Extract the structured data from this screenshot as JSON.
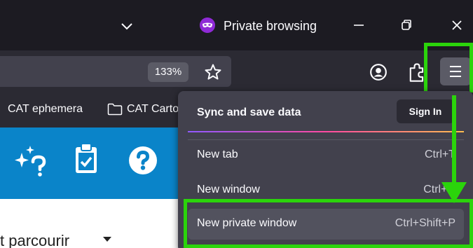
{
  "titlebar": {
    "private_label": "Private browsing"
  },
  "navbar": {
    "zoom_level": "133%"
  },
  "bookmarks": [
    {
      "label": "CAT ephemera"
    },
    {
      "label": "CAT Carto"
    }
  ],
  "page": {
    "browse_label": "t parcourir"
  },
  "app_menu": {
    "sync_title": "Sync and save data",
    "sign_in_label": "Sign In",
    "items": [
      {
        "label": "New tab",
        "shortcut": "Ctrl+T"
      },
      {
        "label": "New window",
        "shortcut": "Ctrl+N"
      },
      {
        "label": "New private window",
        "shortcut": "Ctrl+Shift+P"
      }
    ]
  },
  "colors": {
    "titlebar_bg": "#1c1b22",
    "toolbar_bg": "#2b2a33",
    "menu_bg": "#42414d",
    "page_banner": "#0a84c9",
    "highlight": "#2bd40b",
    "private_purple": "#8f2ad6"
  },
  "icons": {
    "tabs_list": "chevron-down-icon",
    "private": "private-mask-icon",
    "bookmark_star": "star-icon",
    "account": "account-icon",
    "extensions": "puzzle-icon",
    "app_menu": "hamburger-menu-icon",
    "bookmark_folder": "folder-icon",
    "page_tools": [
      "sparkle-question-icon",
      "clipboard-check-icon",
      "help-icon"
    ]
  }
}
